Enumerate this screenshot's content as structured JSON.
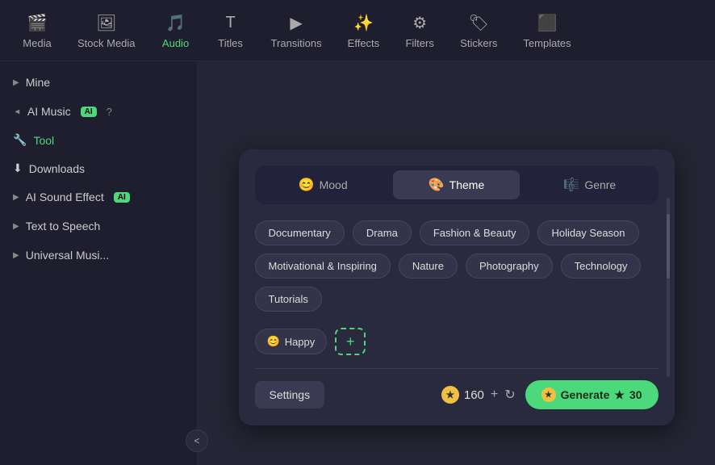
{
  "nav": {
    "items": [
      {
        "id": "media",
        "label": "Media",
        "icon": "🎬",
        "active": false
      },
      {
        "id": "stock-media",
        "label": "Stock Media",
        "icon": "🖼",
        "active": false
      },
      {
        "id": "audio",
        "label": "Audio",
        "icon": "🎵",
        "active": true
      },
      {
        "id": "titles",
        "label": "Titles",
        "icon": "T",
        "active": false
      },
      {
        "id": "transitions",
        "label": "Transitions",
        "icon": "▶",
        "active": false
      },
      {
        "id": "effects",
        "label": "Effects",
        "icon": "✨",
        "active": false
      },
      {
        "id": "filters",
        "label": "Filters",
        "icon": "⚙",
        "active": false
      },
      {
        "id": "stickers",
        "label": "Stickers",
        "icon": "🏷",
        "active": false
      },
      {
        "id": "templates",
        "label": "Templates",
        "icon": "⬛",
        "active": false
      }
    ]
  },
  "sidebar": {
    "items": [
      {
        "id": "mine",
        "label": "Mine",
        "expanded": false,
        "indent": false
      },
      {
        "id": "ai-music",
        "label": "AI Music",
        "badge": "AI",
        "help": true,
        "expanded": true,
        "indent": false
      },
      {
        "id": "tool",
        "label": "Tool",
        "icon": "🔧",
        "active": true,
        "indent": true
      },
      {
        "id": "downloads",
        "label": "Downloads",
        "icon": "⬇",
        "active": false,
        "indent": true
      },
      {
        "id": "ai-sound",
        "label": "AI Sound Effect",
        "badge": "AI",
        "expanded": false,
        "indent": false
      },
      {
        "id": "text-to-speech",
        "label": "Text to Speech",
        "indent": false
      },
      {
        "id": "universal-music",
        "label": "Universal Musi...",
        "indent": false
      }
    ],
    "collapse_label": "<"
  },
  "panel": {
    "tabs": [
      {
        "id": "mood",
        "label": "Mood",
        "icon": "😊",
        "active": false
      },
      {
        "id": "theme",
        "label": "Theme",
        "icon": "🎨",
        "active": true
      },
      {
        "id": "genre",
        "label": "Genre",
        "icon": "🎼",
        "active": false
      }
    ],
    "themes": [
      "Documentary",
      "Drama",
      "Fashion & Beauty",
      "Holiday Season",
      "Motivational & Inspiring",
      "Nature",
      "Photography",
      "Technology",
      "Tutorials"
    ],
    "selected_tags": [
      {
        "label": "Happy",
        "icon": "😊"
      }
    ],
    "add_label": "+",
    "settings_label": "Settings",
    "credits": {
      "value": "160",
      "icon_label": "★"
    },
    "generate_label": "Generate",
    "generate_cost": "30"
  }
}
